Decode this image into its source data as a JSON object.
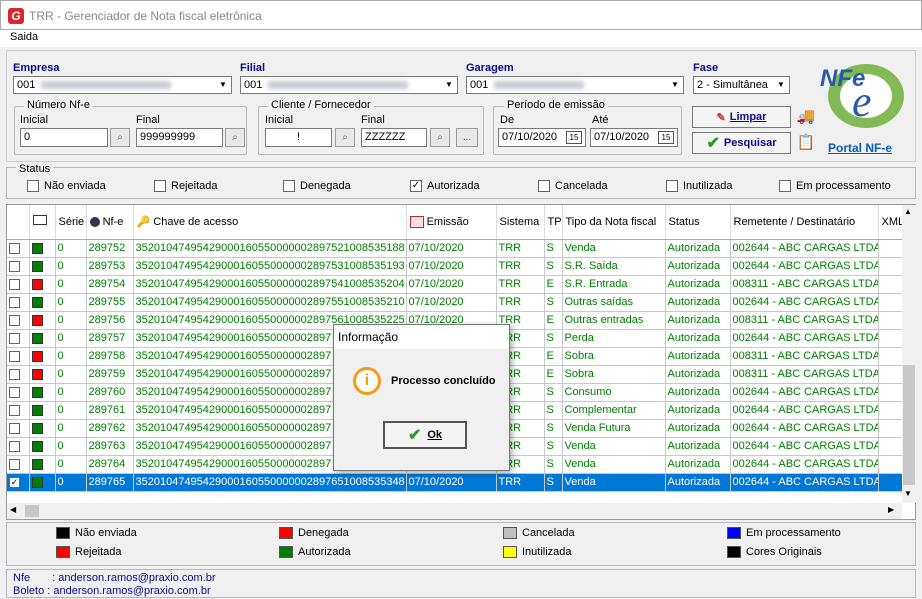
{
  "window": {
    "title": "TRR - Gerenciador de Nota fiscal eletrônica",
    "logo": "G"
  },
  "menu": {
    "saida": "Saida"
  },
  "filters": {
    "empresa": {
      "label": "Empresa",
      "value": "001"
    },
    "filial": {
      "label": "Filial",
      "value": "001"
    },
    "garagem": {
      "label": "Garagem",
      "value": "001"
    },
    "fase": {
      "label": "Fase",
      "value": "2 - Simultânea"
    },
    "nfe_group": {
      "label": "Número Nf-e",
      "initial_label": "Inicial",
      "final_label": "Final",
      "initial": "0",
      "final": "999999999"
    },
    "cliente_group": {
      "label": "Cliente / Fornecedor",
      "initial_label": "Inicial",
      "final_label": "Final",
      "initial": "!",
      "final": "ZZZZZZ",
      "more": "..."
    },
    "periodo_group": {
      "label": "Período de emissão",
      "de_label": "De",
      "ate_label": "Até",
      "de": "07/10/2020",
      "ate": "07/10/2020",
      "cal": "15"
    },
    "limpar": "Limpar",
    "pesquisar": "Pesquisar",
    "portal": "Portal NF-e",
    "nfe_logo": "NFe"
  },
  "status": {
    "label": "Status",
    "items": [
      {
        "label": "Não enviada",
        "checked": ""
      },
      {
        "label": "Rejeitada",
        "checked": ""
      },
      {
        "label": "Denegada",
        "checked": ""
      },
      {
        "label": "Autorizada",
        "checked": "✓"
      },
      {
        "label": "Cancelada",
        "checked": ""
      },
      {
        "label": "Inutilizada",
        "checked": ""
      },
      {
        "label": "Em processamento",
        "checked": ""
      }
    ]
  },
  "grid": {
    "headers": {
      "serie": "Série",
      "nfe": "Nf-e",
      "chave": "Chave de acesso",
      "emissao": "Emissão",
      "sistema": "Sistema",
      "tp": "TP",
      "tipo": "Tipo da Nota fiscal",
      "status": "Status",
      "remetente": "Remetente / Destinatário",
      "xml": "XML"
    },
    "rows": [
      {
        "check": "",
        "color": "#008000",
        "serie": "0",
        "nfe": "289752",
        "chave": "35201047495429000160550000002897521008535188",
        "emissao": "07/10/2020",
        "sistema": "TRR",
        "tp": "S",
        "tipo": "Venda",
        "status": "Autorizada",
        "remetente": "002644 - ABC CARGAS LTDA"
      },
      {
        "check": "",
        "color": "#008000",
        "serie": "0",
        "nfe": "289753",
        "chave": "35201047495429000160550000002897531008535193",
        "emissao": "07/10/2020",
        "sistema": "TRR",
        "tp": "S",
        "tipo": "S.R. Saída",
        "status": "Autorizada",
        "remetente": "002644 - ABC CARGAS LTDA"
      },
      {
        "check": "",
        "color": "#ff0000",
        "serie": "0",
        "nfe": "289754",
        "chave": "35201047495429000160550000002897541008535204",
        "emissao": "07/10/2020",
        "sistema": "TRR",
        "tp": "E",
        "tipo": "S.R. Entrada",
        "status": "Autorizada",
        "remetente": "008311 - ABC CARGAS LTDA"
      },
      {
        "check": "",
        "color": "#008000",
        "serie": "0",
        "nfe": "289755",
        "chave": "35201047495429000160550000002897551008535210",
        "emissao": "07/10/2020",
        "sistema": "TRR",
        "tp": "S",
        "tipo": "Outras saídas",
        "status": "Autorizada",
        "remetente": "002644 - ABC CARGAS LTDA"
      },
      {
        "check": "",
        "color": "#ff0000",
        "serie": "0",
        "nfe": "289756",
        "chave": "35201047495429000160550000002897561008535225",
        "emissao": "07/10/2020",
        "sistema": "TRR",
        "tp": "E",
        "tipo": "Outras entradas",
        "status": "Autorizada",
        "remetente": "008311 - ABC CARGAS LTDA"
      },
      {
        "check": "",
        "color": "#008000",
        "serie": "0",
        "nfe": "289757",
        "chave": "35201047495429000160550000002897",
        "emissao": "",
        "sistema": "TRR",
        "tp": "S",
        "tipo": "Perda",
        "status": "Autorizada",
        "remetente": "002644 - ABC CARGAS LTDA"
      },
      {
        "check": "",
        "color": "#ff0000",
        "serie": "0",
        "nfe": "289758",
        "chave": "35201047495429000160550000002897",
        "emissao": "",
        "sistema": "TRR",
        "tp": "E",
        "tipo": "Sobra",
        "status": "Autorizada",
        "remetente": "008311 - ABC CARGAS LTDA"
      },
      {
        "check": "",
        "color": "#ff0000",
        "serie": "0",
        "nfe": "289759",
        "chave": "35201047495429000160550000002897",
        "emissao": "",
        "sistema": "TRR",
        "tp": "E",
        "tipo": "Sobra",
        "status": "Autorizada",
        "remetente": "008311 - ABC CARGAS LTDA"
      },
      {
        "check": "",
        "color": "#008000",
        "serie": "0",
        "nfe": "289760",
        "chave": "35201047495429000160550000002897",
        "emissao": "",
        "sistema": "TRR",
        "tp": "S",
        "tipo": "Consumo",
        "status": "Autorizada",
        "remetente": "002644 - ABC CARGAS LTDA"
      },
      {
        "check": "",
        "color": "#008000",
        "serie": "0",
        "nfe": "289761",
        "chave": "35201047495429000160550000002897",
        "emissao": "",
        "sistema": "TRR",
        "tp": "S",
        "tipo": "Complementar",
        "status": "Autorizada",
        "remetente": "002644 - ABC CARGAS LTDA"
      },
      {
        "check": "",
        "color": "#008000",
        "serie": "0",
        "nfe": "289762",
        "chave": "35201047495429000160550000002897",
        "emissao": "",
        "sistema": "TRR",
        "tp": "S",
        "tipo": "Venda Futura",
        "status": "Autorizada",
        "remetente": "002644 - ABC CARGAS LTDA"
      },
      {
        "check": "",
        "color": "#008000",
        "serie": "0",
        "nfe": "289763",
        "chave": "35201047495429000160550000002897",
        "emissao": "",
        "sistema": "TRR",
        "tp": "S",
        "tipo": "Venda",
        "status": "Autorizada",
        "remetente": "002644 - ABC CARGAS LTDA"
      },
      {
        "check": "",
        "color": "#008000",
        "serie": "0",
        "nfe": "289764",
        "chave": "35201047495429000160550000002897",
        "emissao": "",
        "sistema": "TRR",
        "tp": "S",
        "tipo": "Venda",
        "status": "Autorizada",
        "remetente": "002644 - ABC CARGAS LTDA"
      },
      {
        "check": "✓",
        "color": "#008000",
        "serie": "0",
        "nfe": "289765",
        "chave": "35201047495429000160550000002897651008535348",
        "emissao": "07/10/2020",
        "sistema": "TRR",
        "tp": "S",
        "tipo": "Venda",
        "status": "Autorizada",
        "remetente": "002644 - ABC CARGAS LTDA",
        "selected": true
      }
    ]
  },
  "legend": [
    {
      "label": "Não enviada",
      "color": "#000000"
    },
    {
      "label": "Denegada",
      "color": "#ff0000"
    },
    {
      "label": "Cancelada",
      "color": "#c0c0c0"
    },
    {
      "label": "Em processamento",
      "color": "#0000ff"
    },
    {
      "label": "Rejeitada",
      "color": "#ff0000"
    },
    {
      "label": "Autorizada",
      "color": "#008000"
    },
    {
      "label": "Inutilizada",
      "color": "#ffff00"
    },
    {
      "label": "Cores Originais",
      "color": "#000000"
    }
  ],
  "footer": {
    "nfe_label": "Nfe",
    "nfe_email": "anderson.ramos@praxio.com.br",
    "boleto_label": "Boleto",
    "boleto_email": "anderson.ramos@praxio.com.br"
  },
  "dialog": {
    "title": "Informação",
    "message": "Processo concluído",
    "ok": "Ok",
    "icon": "i"
  }
}
